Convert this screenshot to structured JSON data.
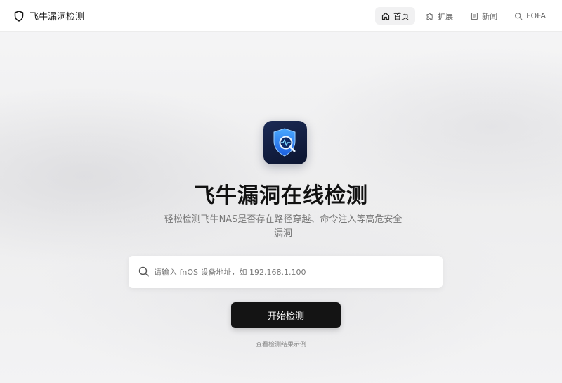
{
  "brand": {
    "title": "飞牛漏洞检测",
    "icon": "shield-icon"
  },
  "nav": {
    "items": [
      {
        "label": "首页",
        "icon": "home-icon",
        "active": true
      },
      {
        "label": "扩展",
        "icon": "puzzle-icon",
        "active": false
      },
      {
        "label": "新闻",
        "icon": "newspaper-icon",
        "active": false
      },
      {
        "label": "FOFA",
        "icon": "search-icon",
        "active": false
      }
    ]
  },
  "hero": {
    "app_icon": "shield-scan-icon",
    "title": "飞牛漏洞在线检测",
    "subtitle": "轻松检测飞牛NAS是否存在路径穿越、命令注入等高危安全漏洞",
    "search": {
      "icon": "search-icon",
      "placeholder": "请输入 fnOS 设备地址，如 192.168.1.100",
      "value": ""
    },
    "start_button": "开始检测",
    "example_link": "查看检测结果示例"
  },
  "colors": {
    "button_bg": "#141414",
    "icon_bg": "#0c1530",
    "icon_accent": "#2f8cff"
  }
}
